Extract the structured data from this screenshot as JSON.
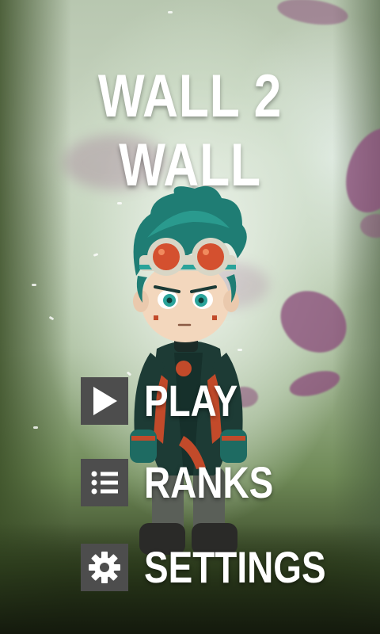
{
  "game": {
    "title": "WALL 2 WALL"
  },
  "menu": {
    "items": [
      {
        "label": "PLAY",
        "icon": "play-icon"
      },
      {
        "label": "RANKS",
        "icon": "list-icon"
      },
      {
        "label": "SETTINGS",
        "icon": "gear-icon"
      }
    ]
  },
  "colors": {
    "icon_box": "#4d4d4d",
    "text": "#ffffff",
    "petal": "#8a4a7a",
    "hair": "#1f7d74",
    "goggle_lens": "#d4502f",
    "suit_dark": "#1d3b35",
    "suit_accent": "#c24a2a"
  }
}
